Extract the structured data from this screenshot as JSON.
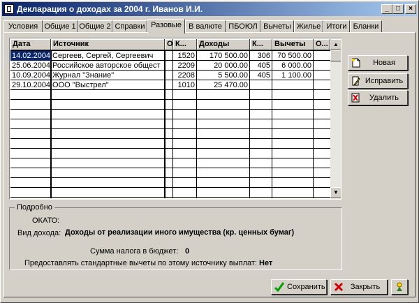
{
  "window": {
    "title": "Декларация о доходах за 2004 г. Иванов И.И."
  },
  "tabs": [
    "Условия",
    "Общие 1",
    "Общие 2",
    "Справки",
    "Разовые",
    "В валюте",
    "ПБОЮЛ",
    "Вычеты",
    "Жилье",
    "Итоги",
    "Бланки"
  ],
  "active_tab": "Разовые",
  "grid": {
    "headers": [
      "Дата",
      "Источник",
      "О",
      "К...",
      "Доходы",
      "К...",
      "Вычеты",
      "О..."
    ],
    "rows": [
      [
        "14.02.2004",
        "Сергеев, Сергей, Сергеевич",
        "",
        "1520",
        "170 500.00",
        "306",
        "70 500.00",
        ""
      ],
      [
        "25.06.2004",
        "Российское авторское общест",
        "",
        "2209",
        "20 000.00",
        "405",
        "6 000.00",
        ""
      ],
      [
        "10.09.2004",
        "Журнал \"Знание\"",
        "",
        "2208",
        "5 500.00",
        "405",
        "1 100.00",
        ""
      ],
      [
        "29.10.2004",
        "ООО \"Выстрел\"",
        "",
        "1010",
        "25 470.00",
        "",
        "",
        ""
      ]
    ]
  },
  "actions": {
    "new": "Новая",
    "edit": "Исправить",
    "delete": "Удалить"
  },
  "details": {
    "title": "Подробно",
    "okato_label": "ОКАТО:",
    "okato_value": "",
    "income_type_label": "Вид дохода:",
    "income_type_value": "Доходы от реализации иного имущества (кр. ценных бумаг)",
    "tax_label": "Сумма налога в бюджет:",
    "tax_value": "0",
    "std_deductions_label": "Предоставлять стандартные вычеты по этому источнику выплат:",
    "std_deductions_value": "Нет"
  },
  "footer": {
    "save": "Сохранить",
    "close": "Закрыть"
  }
}
